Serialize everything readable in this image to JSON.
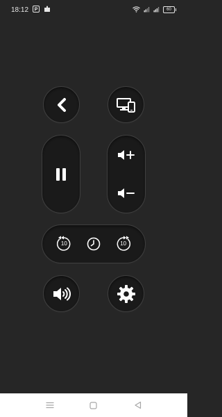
{
  "status_bar": {
    "time": "18:12",
    "notification_icons": [
      "p-app-icon",
      "puzzle-icon"
    ],
    "battery_level": "60",
    "signal_icons": [
      "wifi-icon",
      "cellular-signal-icon",
      "cellular-signal-icon"
    ]
  },
  "remote": {
    "back": {
      "icon": "chevron-left-icon"
    },
    "cast": {
      "icon": "devices-icon"
    },
    "play_pause": {
      "icon": "pause-icon"
    },
    "volume_up": {
      "icon": "volume-up-icon"
    },
    "volume_down": {
      "icon": "volume-down-icon"
    },
    "rewind": {
      "icon": "rewind-10-icon",
      "label": "10"
    },
    "sleep_timer": {
      "icon": "clock-icon"
    },
    "forward": {
      "icon": "forward-10-icon",
      "label": "10"
    },
    "speaker": {
      "icon": "speaker-icon"
    },
    "settings": {
      "icon": "gear-icon"
    }
  },
  "nav_bar": {
    "items": [
      "menu-icon",
      "home-square-icon",
      "back-triangle-icon"
    ]
  },
  "colors": {
    "background": "#262626",
    "button": "#1a1a1a",
    "icon": "#ffffff",
    "nav_bar": "#ffffff"
  }
}
